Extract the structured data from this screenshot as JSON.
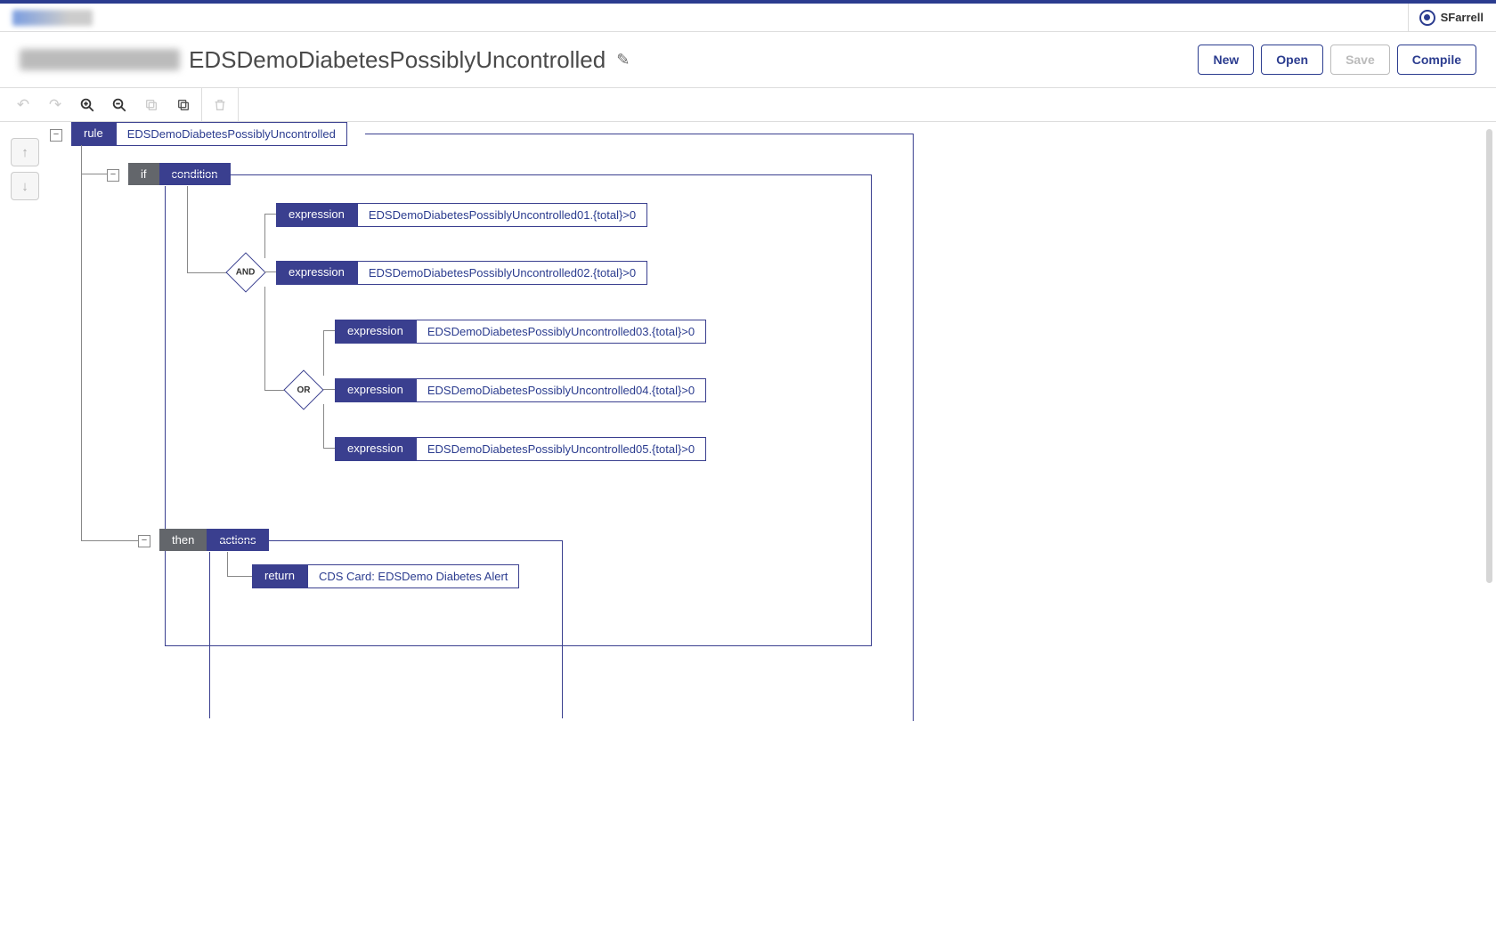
{
  "header": {
    "username": "SFarrell"
  },
  "title": "EDSDemoDiabetesPossiblyUncontrolled",
  "buttons": {
    "new": "New",
    "open": "Open",
    "save": "Save",
    "compile": "Compile"
  },
  "rule": {
    "keyword": "rule",
    "name": "EDSDemoDiabetesPossiblyUncontrolled",
    "if_kw": "if",
    "condition_kw": "condition",
    "and_op": "AND",
    "or_op": "OR",
    "expression_kw": "expression",
    "expressions": [
      "EDSDemoDiabetesPossiblyUncontrolled01.{total}>0",
      "EDSDemoDiabetesPossiblyUncontrolled02.{total}>0",
      "EDSDemoDiabetesPossiblyUncontrolled03.{total}>0",
      "EDSDemoDiabetesPossiblyUncontrolled04.{total}>0",
      "EDSDemoDiabetesPossiblyUncontrolled05.{total}>0"
    ],
    "then_kw": "then",
    "actions_kw": "actions",
    "return_kw": "return",
    "return_val": "CDS Card: EDSDemo Diabetes Alert"
  }
}
